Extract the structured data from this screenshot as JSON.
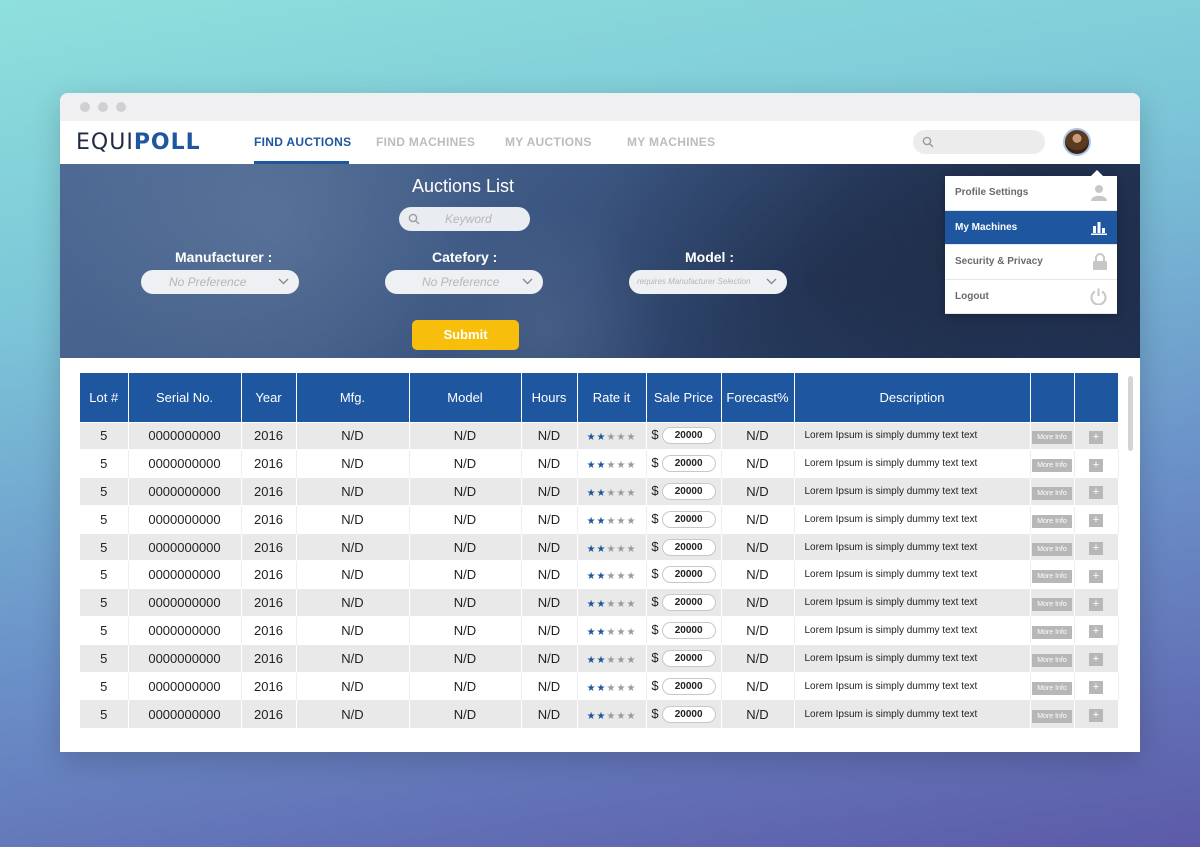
{
  "app": {
    "logo_part1": "EQUI",
    "logo_part2": "POLL"
  },
  "nav": {
    "tabs": [
      "FIND AUCTIONS",
      "FIND MACHINES",
      "MY AUCTIONS",
      "MY MACHINES"
    ],
    "active_tab": "FIND AUCTIONS"
  },
  "hero": {
    "title": "Auctions List",
    "keyword_placeholder": "Keyword",
    "manufacturer_label": "Manufacturer :",
    "manufacturer_value": "No Preference",
    "category_label": "Catefory :",
    "category_value": "No Preference",
    "model_label": "Model :",
    "model_value": "requires Manufacturer Selection",
    "submit_label": "Submit"
  },
  "user_menu": {
    "items": [
      {
        "label": "Profile Settings",
        "icon": "user-icon"
      },
      {
        "label": "My Machines",
        "icon": "chart-icon",
        "active": true
      },
      {
        "label": "Security & Privacy",
        "icon": "lock-icon"
      },
      {
        "label": "Logout",
        "icon": "power-icon"
      }
    ]
  },
  "table": {
    "headers": [
      "Lot #",
      "Serial No.",
      "Year",
      "Mfg.",
      "Model",
      "Hours",
      "Rate it",
      "Sale Price",
      "Forecast%",
      "Description",
      "",
      ""
    ],
    "more_info_label": "More Info",
    "plus_label": "+",
    "currency": "$",
    "rows": [
      {
        "lot": "5",
        "serial": "0000000000",
        "year": "2016",
        "mfg": "N/D",
        "model": "N/D",
        "hours": "N/D",
        "rating": 2,
        "price": "20000",
        "forecast": "N/D",
        "description": "Lorem Ipsum is simply dummy text  text"
      },
      {
        "lot": "5",
        "serial": "0000000000",
        "year": "2016",
        "mfg": "N/D",
        "model": "N/D",
        "hours": "N/D",
        "rating": 2,
        "price": "20000",
        "forecast": "N/D",
        "description": "Lorem Ipsum is simply dummy text  text"
      },
      {
        "lot": "5",
        "serial": "0000000000",
        "year": "2016",
        "mfg": "N/D",
        "model": "N/D",
        "hours": "N/D",
        "rating": 2,
        "price": "20000",
        "forecast": "N/D",
        "description": "Lorem Ipsum is simply dummy text  text"
      },
      {
        "lot": "5",
        "serial": "0000000000",
        "year": "2016",
        "mfg": "N/D",
        "model": "N/D",
        "hours": "N/D",
        "rating": 2,
        "price": "20000",
        "forecast": "N/D",
        "description": "Lorem Ipsum is simply dummy text  text"
      },
      {
        "lot": "5",
        "serial": "0000000000",
        "year": "2016",
        "mfg": "N/D",
        "model": "N/D",
        "hours": "N/D",
        "rating": 2,
        "price": "20000",
        "forecast": "N/D",
        "description": "Lorem Ipsum is simply dummy text  text"
      },
      {
        "lot": "5",
        "serial": "0000000000",
        "year": "2016",
        "mfg": "N/D",
        "model": "N/D",
        "hours": "N/D",
        "rating": 2,
        "price": "20000",
        "forecast": "N/D",
        "description": "Lorem Ipsum is simply dummy text  text"
      },
      {
        "lot": "5",
        "serial": "0000000000",
        "year": "2016",
        "mfg": "N/D",
        "model": "N/D",
        "hours": "N/D",
        "rating": 2,
        "price": "20000",
        "forecast": "N/D",
        "description": "Lorem Ipsum is simply dummy text  text"
      },
      {
        "lot": "5",
        "serial": "0000000000",
        "year": "2016",
        "mfg": "N/D",
        "model": "N/D",
        "hours": "N/D",
        "rating": 2,
        "price": "20000",
        "forecast": "N/D",
        "description": "Lorem Ipsum is simply dummy text  text"
      },
      {
        "lot": "5",
        "serial": "0000000000",
        "year": "2016",
        "mfg": "N/D",
        "model": "N/D",
        "hours": "N/D",
        "rating": 2,
        "price": "20000",
        "forecast": "N/D",
        "description": "Lorem Ipsum is simply dummy text  text"
      },
      {
        "lot": "5",
        "serial": "0000000000",
        "year": "2016",
        "mfg": "N/D",
        "model": "N/D",
        "hours": "N/D",
        "rating": 2,
        "price": "20000",
        "forecast": "N/D",
        "description": "Lorem Ipsum is simply dummy text  text"
      },
      {
        "lot": "5",
        "serial": "0000000000",
        "year": "2016",
        "mfg": "N/D",
        "model": "N/D",
        "hours": "N/D",
        "rating": 2,
        "price": "20000",
        "forecast": "N/D",
        "description": "Lorem Ipsum is simply dummy text  text"
      }
    ]
  },
  "colors": {
    "accent": "#1e56a0",
    "submit": "#f7be0b",
    "row_alt": "#e9e9e9"
  }
}
